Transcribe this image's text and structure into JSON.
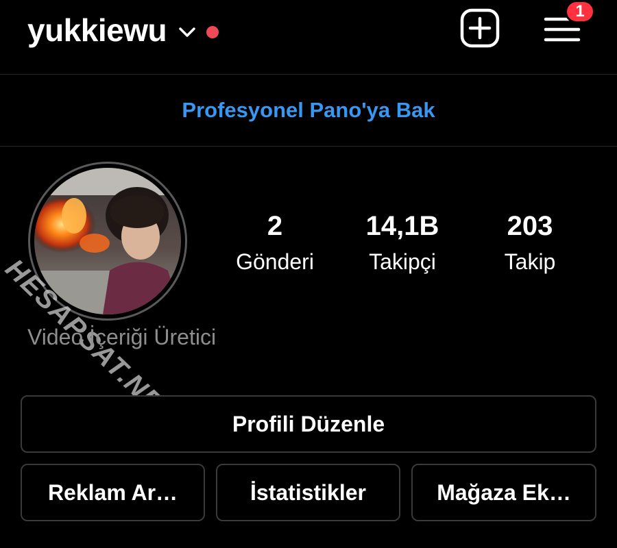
{
  "header": {
    "username": "yukkiewu",
    "menu_badge_count": "1",
    "icons": {
      "account_switch": "chevron-down-icon",
      "create": "plus-square-icon",
      "menu": "hamburger-menu-icon"
    }
  },
  "professional_dashboard": {
    "link_text": "Profesyonel Pano'ya Bak",
    "color": "#3897f0"
  },
  "profile": {
    "stats": {
      "posts": {
        "value": "2",
        "label": "Gönderi"
      },
      "followers": {
        "value": "14,1B",
        "label": "Takipçi"
      },
      "following": {
        "value": "203",
        "label": "Takip"
      }
    },
    "category": "Video İçeriği Üretici"
  },
  "watermark": "HESAPSAT.NET",
  "buttons": {
    "edit_profile": "Profili Düzenle",
    "ad_tools": "Reklam Ar…",
    "insights": "İstatistikler",
    "add_shop": "Mağaza Ek…"
  },
  "colors": {
    "background": "#000000",
    "badge": "#ff3040",
    "notification_dot": "#ed4956",
    "secondary_text": "#8e8e8e"
  }
}
